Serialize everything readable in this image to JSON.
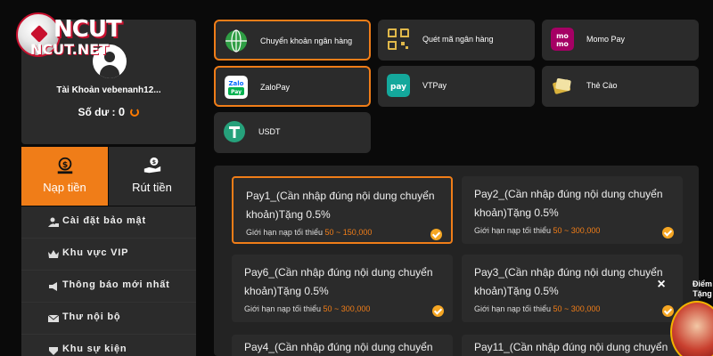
{
  "logo": {
    "text_main": "NCUT",
    "text_sub": "NCUT.NET"
  },
  "account": {
    "name": "Tài Khoản vebenanh12...",
    "balance_label": "Số dư :",
    "balance_value": "0"
  },
  "tabs": [
    {
      "label": "Nạp tiền",
      "icon": "wallet-icon",
      "active": true
    },
    {
      "label": "Rút tiền",
      "icon": "hand-money-icon",
      "active": false
    }
  ],
  "menu": [
    {
      "label": "Cài đặt bảo mật",
      "icon": "user-lock-icon"
    },
    {
      "label": "Khu vực VIP",
      "icon": "crown-icon"
    },
    {
      "label": "Thông báo mới nhất",
      "icon": "megaphone-icon"
    },
    {
      "label": "Thư nội bộ",
      "icon": "mail-icon"
    },
    {
      "label": "Khu sự kiện",
      "icon": "event-icon"
    }
  ],
  "payment_methods": [
    {
      "label": "Chuyển khoản ngân hàng",
      "icon": "globe-icon",
      "active": true
    },
    {
      "label": "Quét mã ngân hàng",
      "icon": "qr-code-icon",
      "active": false
    },
    {
      "label": "Momo Pay",
      "icon": "momo-icon",
      "active": false
    },
    {
      "label": "ZaloPay",
      "icon": "zalopay-icon",
      "active": true
    },
    {
      "label": "VTPay",
      "icon": "vtpay-icon",
      "active": false
    },
    {
      "label": "Thẻ Cào",
      "icon": "scratch-card-icon",
      "active": false
    },
    {
      "label": "USDT",
      "icon": "tether-icon",
      "active": false
    }
  ],
  "pay_options": [
    {
      "title": "Pay1_(Cần nhập đúng nội dung chuyển khoản)Tặng 0.5%",
      "limit_label": "Giới hạn nạp tối thiểu",
      "min": "50",
      "sep": "~",
      "max": "150,000",
      "selected": true
    },
    {
      "title": "Pay2_(Cần nhập đúng nội dung chuyển khoản)Tặng 0.5%",
      "limit_label": "Giới hạn nạp tối thiểu",
      "min": "50",
      "sep": "~",
      "max": "300,000",
      "selected": false
    },
    {
      "title": "Pay6_(Cần nhập đúng nội dung chuyển khoản)Tặng 0.5%",
      "limit_label": "Giới hạn nạp tối thiểu",
      "min": "50",
      "sep": "~",
      "max": "300,000",
      "selected": false
    },
    {
      "title": "Pay3_(Cần nhập đúng nội dung chuyển khoản)Tặng 0.5%",
      "limit_label": "Giới hạn nạp tối thiểu",
      "min": "50",
      "sep": "~",
      "max": "300,000",
      "selected": false
    },
    {
      "title": "Pay4_(Cần nhập đúng nội dung chuyển",
      "limit_label": "",
      "min": "",
      "sep": "",
      "max": "",
      "selected": false
    },
    {
      "title": "Pay11_(Cần nhập đúng nội dung chuyển",
      "limit_label": "",
      "min": "",
      "sep": "",
      "max": "",
      "selected": false
    }
  ],
  "promo": {
    "label": "Điểm Tặng",
    "close": "×"
  },
  "colors": {
    "accent": "#f07d18",
    "panel": "#2b2b2b",
    "background": "#0a0a0a"
  }
}
